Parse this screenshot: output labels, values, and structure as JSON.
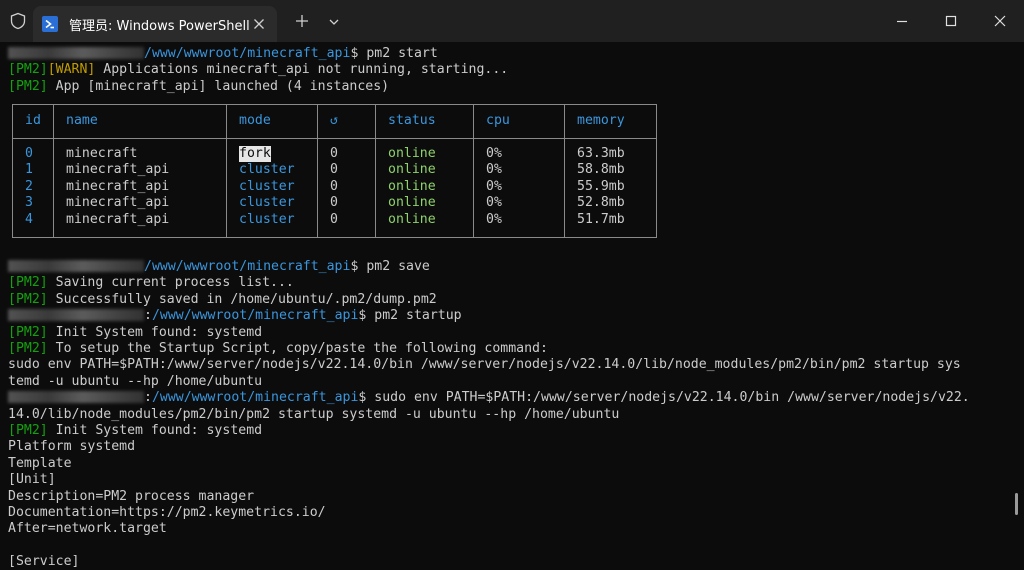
{
  "window": {
    "tab_title": "管理员: Windows PowerShell",
    "icons": {
      "shield": "shield-icon",
      "powershell": "powershell-icon",
      "close_tab": "close-icon",
      "new_tab": "plus-icon",
      "dropdown": "chevron-down-icon",
      "minimize": "minimize-icon",
      "maximize": "maximize-icon",
      "close_window": "close-icon"
    }
  },
  "colors": {
    "background": "#0c0c0c",
    "titlebar": "#202020",
    "tab_active": "#2b2b2b",
    "text": "#cccccc",
    "pm2_tag": "#13a10e",
    "warn": "#c19c00",
    "cyan": "#3a96dd",
    "online": "#8fd16b"
  },
  "terminal": {
    "prompt_path": "/www/wwwroot/minecraft_api",
    "cmd_start": "$ pm2 start",
    "pm2_tag": "[PM2]",
    "warn_tag": "[WARN]",
    "warn_msg": " Applications minecraft_api not running, starting...",
    "launched_msg": " App [minecraft_api] launched (4 instances)",
    "cmd_save": "$ pm2 save",
    "saving_msg": " Saving current process list...",
    "saved_msg": " Successfully saved in /home/ubuntu/.pm2/dump.pm2",
    "cmd_startup_prefix": ":",
    "cmd_startup": "$ pm2 startup",
    "init_msg": " Init System found: systemd",
    "setup_msg": " To setup the Startup Script, copy/paste the following command:",
    "sudo_line1": "sudo env PATH=$PATH:/www/server/nodejs/v22.14.0/bin /www/server/nodejs/v22.14.0/lib/node_modules/pm2/bin/pm2 startup sys",
    "sudo_line2": "temd -u ubuntu --hp /home/ubuntu",
    "cmd_sudo_prefix": ":",
    "cmd_sudo_line1": "$ sudo env PATH=$PATH:/www/server/nodejs/v22.14.0/bin /www/server/nodejs/v22.",
    "cmd_sudo_line2": "14.0/lib/node_modules/pm2/bin/pm2 startup systemd -u ubuntu --hp /home/ubuntu",
    "init_msg2": " Init System found: systemd",
    "platform": "Platform systemd",
    "template": "Template",
    "unit": "[Unit]",
    "description": "Description=PM2 process manager",
    "documentation": "Documentation=https://pm2.keymetrics.io/",
    "after": "After=network.target",
    "service": "[Service]"
  },
  "pm2_table": {
    "headers": {
      "id": "id",
      "name": "name",
      "mode": "mode",
      "restarts": "↺",
      "status": "status",
      "cpu": "cpu",
      "memory": "memory"
    },
    "rows": [
      {
        "id": "0",
        "name": "minecraft",
        "mode": "fork",
        "restarts": "0",
        "status": "online",
        "cpu": "0%",
        "memory": "63.3mb"
      },
      {
        "id": "1",
        "name": "minecraft_api",
        "mode": "cluster",
        "restarts": "0",
        "status": "online",
        "cpu": "0%",
        "memory": "58.8mb"
      },
      {
        "id": "2",
        "name": "minecraft_api",
        "mode": "cluster",
        "restarts": "0",
        "status": "online",
        "cpu": "0%",
        "memory": "55.9mb"
      },
      {
        "id": "3",
        "name": "minecraft_api",
        "mode": "cluster",
        "restarts": "0",
        "status": "online",
        "cpu": "0%",
        "memory": "52.8mb"
      },
      {
        "id": "4",
        "name": "minecraft_api",
        "mode": "cluster",
        "restarts": "0",
        "status": "online",
        "cpu": "0%",
        "memory": "51.7mb"
      }
    ]
  }
}
